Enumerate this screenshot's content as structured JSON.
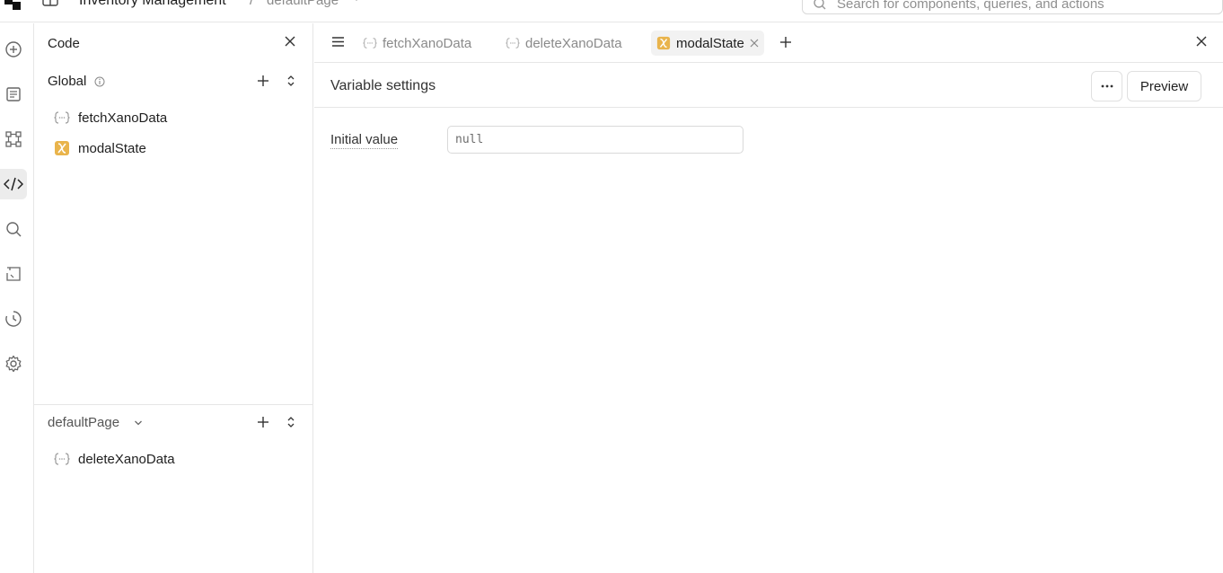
{
  "topbar": {
    "app_title": "Inventory Management",
    "separator": "/",
    "page_name": "defaultPage",
    "search_placeholder": "Search for components, queries, and actions"
  },
  "rail": {
    "icons": [
      "add-circle-icon",
      "document-icon",
      "components-icon",
      "code-icon",
      "search-icon",
      "state-icon",
      "history-icon",
      "gear-icon"
    ],
    "active": "code-icon"
  },
  "code_panel": {
    "title": "Code",
    "global": {
      "label": "Global",
      "items": [
        {
          "name": "fetchXanoData",
          "kind": "query"
        },
        {
          "name": "modalState",
          "kind": "variable"
        }
      ]
    },
    "page": {
      "label": "defaultPage",
      "items": [
        {
          "name": "deleteXanoData",
          "kind": "query"
        }
      ]
    }
  },
  "editor": {
    "tabs": [
      {
        "label": "fetchXanoData",
        "kind": "query",
        "active": false
      },
      {
        "label": "deleteXanoData",
        "kind": "query",
        "active": false
      },
      {
        "label": "modalState",
        "kind": "variable",
        "active": true
      }
    ],
    "settings_title": "Variable settings",
    "more_label": "···",
    "preview_label": "Preview",
    "initial_value_label": "Initial value",
    "initial_value": "",
    "initial_value_placeholder": "null"
  },
  "colors": {
    "variable_accent": "#e9b44c",
    "border": "#e6e6e6",
    "muted_text": "#8a8a8a",
    "active_bg": "#ececec"
  }
}
